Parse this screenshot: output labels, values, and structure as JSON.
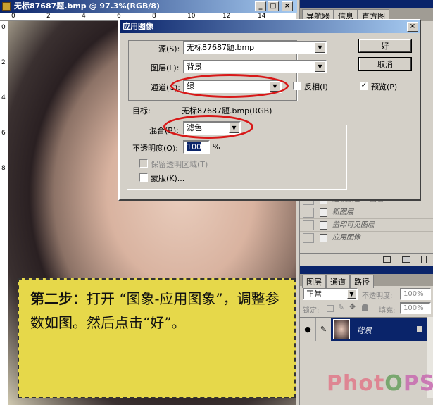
{
  "doc_window": {
    "title": "无标87687题.bmp @ 97.3%(RGB/8)",
    "ruler_ticks": [
      "0",
      "2",
      "4",
      "6",
      "8",
      "10",
      "12",
      "14"
    ],
    "vruler_ticks": [
      "0",
      "2",
      "4",
      "6",
      "8"
    ]
  },
  "dialog": {
    "title": "应用图像",
    "source_label": "源(S):",
    "source_value": "无标87687题.bmp",
    "layer_label": "图层(L):",
    "layer_value": "背景",
    "channel_label": "通道(C):",
    "channel_value": "绿",
    "invert_label": "反相(I)",
    "ok": "好",
    "cancel": "取消",
    "preview_label": "预览(P)",
    "target_label": "目标:",
    "target_value": "无标87687题.bmp(RGB)",
    "blend_label": "混合(B):",
    "blend_value": "滤色",
    "opacity_label": "不透明度(O):",
    "opacity_value": "100",
    "opacity_unit": "%",
    "preserve_label": "保留透明区域(T)",
    "mask_label": "蒙版(K)...",
    "highlight_color": "#d81818"
  },
  "nav_panel": {
    "tabs": [
      "导航器",
      "信息",
      "直方图"
    ]
  },
  "history": {
    "items": [
      "选取颜色 1 图层",
      "新图层",
      "盖印可见图层",
      "应用图像"
    ]
  },
  "layers_panel": {
    "tabs": [
      "图层",
      "通道",
      "路径"
    ],
    "blend_mode": "正常",
    "opacity_label": "不透明度:",
    "opacity_value": "100%",
    "lock_label": "锁定:",
    "fill_label": "填充:",
    "fill_value": "100%",
    "layer_name": "背景"
  },
  "caption": {
    "step": "第二步",
    "text": "：打开 “图象-应用图象”，调整参数如图。然后点击“好”。"
  },
  "watermark": "PhotOPS"
}
